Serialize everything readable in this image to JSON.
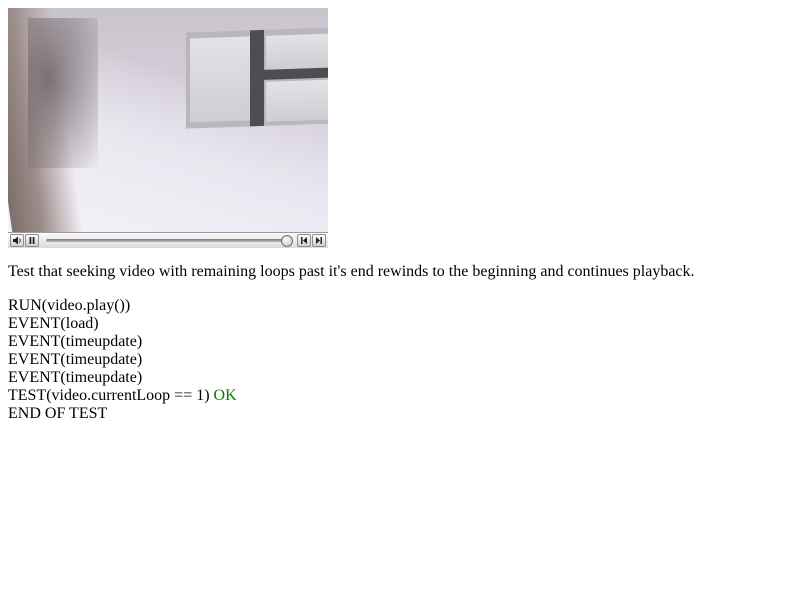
{
  "video_player": {
    "controls": {
      "mute_button": "speaker-icon",
      "play_pause_button": "pause-icon",
      "seek_back_button": "rewind-icon",
      "seek_forward_button": "fast-forward-icon",
      "scrubber_position": 0.98
    }
  },
  "description": "Test that seeking video with remaining loops past it's end rewinds to the beginning and continues playback.",
  "log": {
    "lines": [
      {
        "text": "RUN(video.play())",
        "status": ""
      },
      {
        "text": "EVENT(load)",
        "status": ""
      },
      {
        "text": "EVENT(timeupdate)",
        "status": ""
      },
      {
        "text": "EVENT(timeupdate)",
        "status": ""
      },
      {
        "text": "EVENT(timeupdate)",
        "status": ""
      },
      {
        "text": "TEST(video.currentLoop == 1)",
        "status": "OK"
      },
      {
        "text": "END OF TEST",
        "status": ""
      }
    ]
  },
  "colors": {
    "ok": "#008000",
    "text": "#000000",
    "background": "#ffffff"
  }
}
